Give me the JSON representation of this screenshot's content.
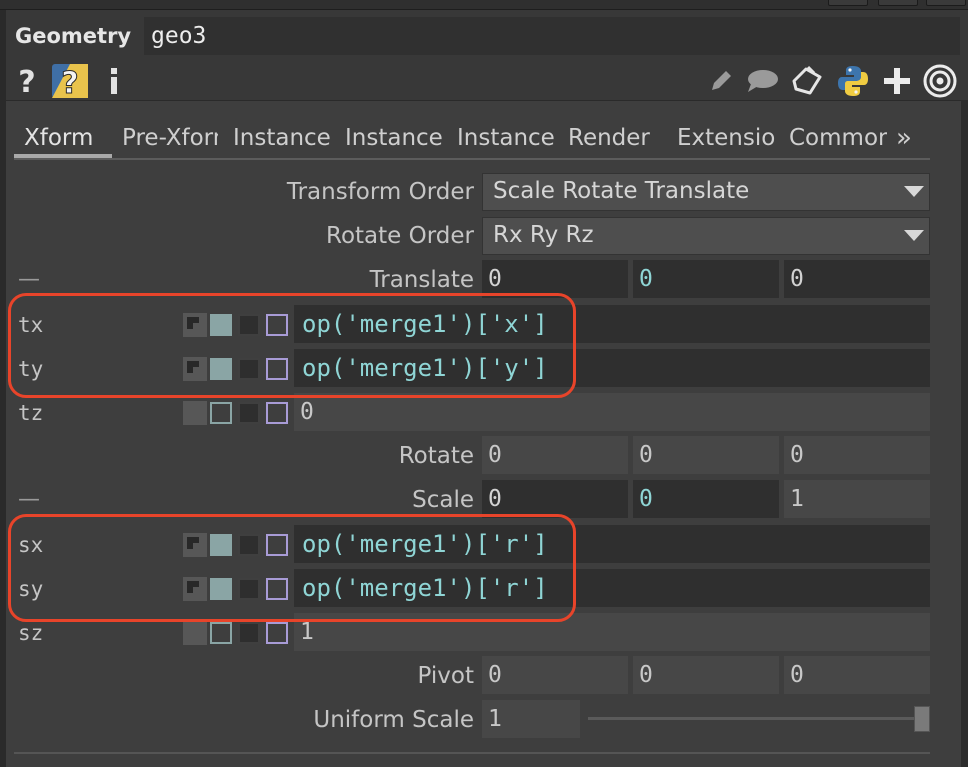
{
  "header": {
    "op_type": "Geometry",
    "op_name": "geo3"
  },
  "toolbar": {
    "left_icons": [
      "help-icon",
      "python-help-icon",
      "info-icon"
    ],
    "right_icons": [
      "pencil-icon",
      "comment-icon",
      "clipboard-icon",
      "python-icon",
      "add-icon",
      "target-icon"
    ]
  },
  "tabs": [
    {
      "label": "Xform",
      "active": true
    },
    {
      "label": "Pre-Xform"
    },
    {
      "label": "Instance"
    },
    {
      "label": "Instance"
    },
    {
      "label": "Instance"
    },
    {
      "label": "Render"
    },
    {
      "label": "Extensions"
    },
    {
      "label": "Common"
    }
  ],
  "tabs_more": "»",
  "params": {
    "transform_order": {
      "label": "Transform Order",
      "value": "Scale Rotate Translate"
    },
    "rotate_order": {
      "label": "Rotate Order",
      "value": "Rx Ry Rz"
    },
    "translate": {
      "label": "Translate",
      "values": [
        "0",
        "0",
        "0"
      ]
    },
    "tx": {
      "label": "tx",
      "value": "op('merge1')['x']"
    },
    "ty": {
      "label": "ty",
      "value": "op('merge1')['y']"
    },
    "tz": {
      "label": "tz",
      "value": "0"
    },
    "rotate": {
      "label": "Rotate",
      "values": [
        "0",
        "0",
        "0"
      ]
    },
    "scale": {
      "label": "Scale",
      "values": [
        "0",
        "0",
        "1"
      ]
    },
    "sx": {
      "label": "sx",
      "value": "op('merge1')['r']"
    },
    "sy": {
      "label": "sy",
      "value": "op('merge1')['r']"
    },
    "sz": {
      "label": "sz",
      "value": "1"
    },
    "pivot": {
      "label": "Pivot",
      "values": [
        "0",
        "0",
        "0"
      ]
    },
    "uniform_scale": {
      "label": "Uniform Scale",
      "value": "1",
      "slider_fraction": 1.0
    }
  },
  "collapse_glyph": "—",
  "colors": {
    "accent_cyan": "#8fd5d5",
    "highlight_red": "#e8442a",
    "mode_teal": "#8aa5a5",
    "mode_purple": "#a89bd6"
  }
}
